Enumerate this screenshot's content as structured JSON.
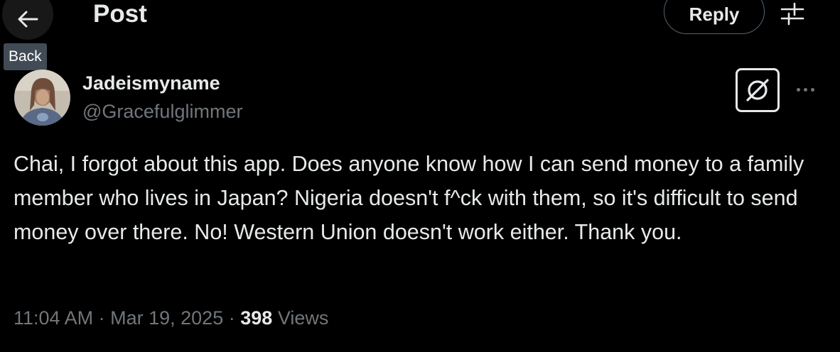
{
  "header": {
    "back_icon": "arrow-left-icon",
    "back_tooltip": "Back",
    "title": "Post",
    "reply_label": "Reply",
    "filter_icon": "sliders-icon"
  },
  "post": {
    "author": {
      "display_name": "Jadeismyname",
      "handle": "@Gracefulglimmer",
      "avatar": "profile-photo"
    },
    "grok_icon": "grok-icon",
    "more_icon": "more-horizontal-icon",
    "text": "Chai, I forgot about this app. Does anyone know how I can send money to a family member who lives in Japan? Nigeria doesn't f^ck with them, so it's difficult to send money over there. No! Western Union doesn't work either. Thank you.",
    "time": "11:04 AM",
    "separator": "·",
    "date": "Mar 19, 2025",
    "views_count": "398",
    "views_label": "Views"
  },
  "colors": {
    "background": "#000000",
    "text_primary": "#e7e9ea",
    "text_secondary": "#71767b",
    "tooltip_bg": "#414b55",
    "border": "#536471"
  }
}
